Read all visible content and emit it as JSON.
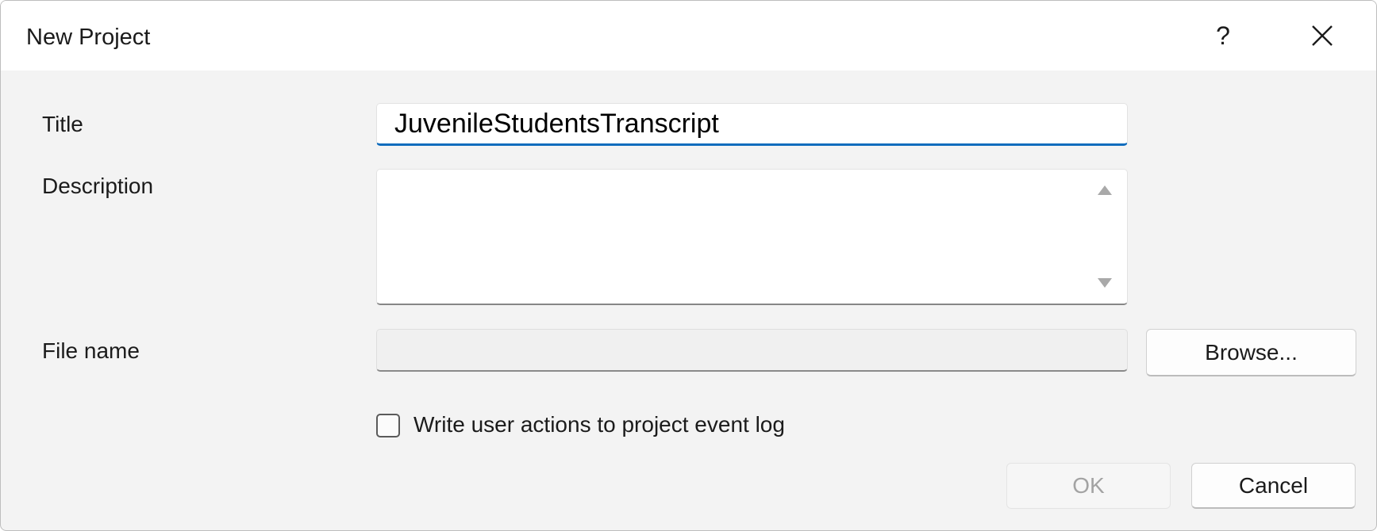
{
  "dialog": {
    "title": "New Project",
    "help_label": "?"
  },
  "form": {
    "title_label": "Title",
    "title_value": "JuvenileStudentsTranscript",
    "description_label": "Description",
    "description_value": "",
    "file_name_label": "File name",
    "file_name_value": "",
    "browse_label": "Browse...",
    "checkbox_label": "Write user actions to project event log",
    "checkbox_checked": false
  },
  "buttons": {
    "ok_label": "OK",
    "cancel_label": "Cancel"
  },
  "colors": {
    "accent": "#0f6cbd",
    "dialog_bg": "#f3f3f3",
    "disabled_text": "#a3a3a3"
  },
  "icons": {
    "close": "close-icon",
    "scroll_up": "scroll-up-arrow-icon",
    "scroll_down": "scroll-down-arrow-icon"
  }
}
